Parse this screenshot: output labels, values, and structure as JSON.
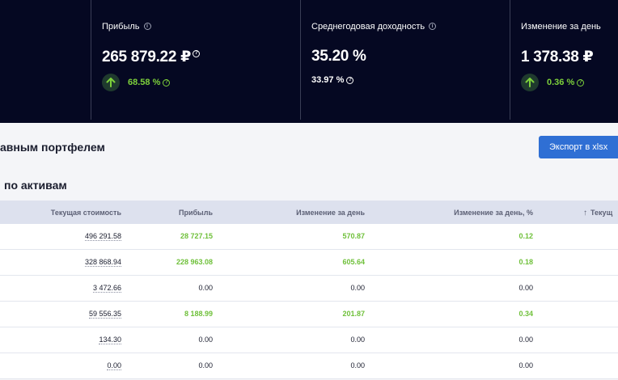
{
  "summary": [
    {
      "label": "Прибыль",
      "value": "265 879.22 ₽",
      "sub": "68.58 %",
      "sub_trend": "up"
    },
    {
      "label": "Среднегодовая доходность",
      "value": "35.20 %",
      "sub": "33.97 %",
      "sub_trend": "none"
    },
    {
      "label": "Изменение за день",
      "value": "1 378.38 ₽",
      "sub": "0.36 %",
      "sub_trend": "up"
    }
  ],
  "icons": {
    "info": "i",
    "help": "?"
  },
  "section1_title": "авным портфелем",
  "export_label": "Экспорт в xlsx",
  "section2_title": "по активам",
  "table": {
    "headers": [
      "Текущая стоимость",
      "Прибыль",
      "Изменение за день",
      "Изменение за день, %",
      "Текущ"
    ],
    "rows": [
      [
        "496 291.58",
        "28 727.15",
        "570.87",
        "0.12"
      ],
      [
        "328 868.94",
        "228 963.08",
        "605.64",
        "0.18"
      ],
      [
        "3 472.66",
        "0.00",
        "0.00",
        "0.00"
      ],
      [
        "59 556.35",
        "8 188.99",
        "201.87",
        "0.34"
      ],
      [
        "134.30",
        "0.00",
        "0.00",
        "0.00"
      ],
      [
        "0.00",
        "0.00",
        "0.00",
        "0.00"
      ]
    ]
  },
  "colors": {
    "header_bg": "#050822",
    "accent_green": "#6fc03a",
    "button_blue": "#2f6fd4"
  }
}
